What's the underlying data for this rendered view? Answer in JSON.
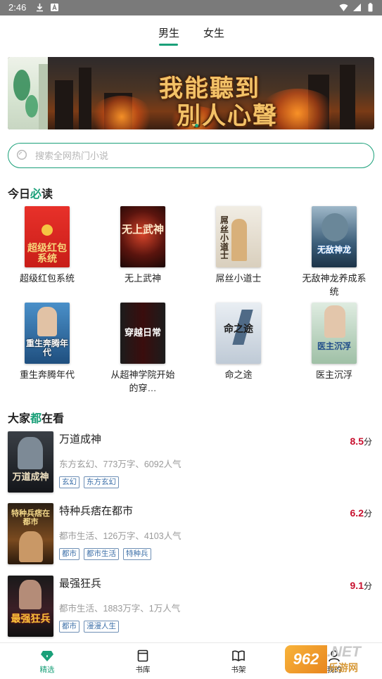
{
  "status_bar": {
    "time": "2:46"
  },
  "tabs": [
    {
      "label": "男生",
      "active": true
    },
    {
      "label": "女生",
      "active": false
    }
  ],
  "banner": {
    "title_line1": "我能聽到",
    "title_line2": "別人心聲"
  },
  "search": {
    "placeholder": "搜索全网热门小说"
  },
  "section_today": {
    "title_pre": "今日",
    "title_hl": "必",
    "title_post": "读"
  },
  "today_books": [
    {
      "title": "超级红包系统",
      "cover_text": "超级红包系统"
    },
    {
      "title": "无上武神",
      "cover_text": "无上武神"
    },
    {
      "title": "屌丝小道士",
      "cover_text": "屌丝小道士"
    },
    {
      "title": "无敌神龙养成系统",
      "cover_text": "无敌神龙"
    },
    {
      "title": "重生奔腾年代",
      "cover_text": "重生奔腾年代"
    },
    {
      "title": "从超神学院开始的穿…",
      "cover_text": "穿越日常"
    },
    {
      "title": "命之途",
      "cover_text": "命之途"
    },
    {
      "title": "医主沉浮",
      "cover_text": "医主沉浮"
    }
  ],
  "section_popular": {
    "title_pre": "大家",
    "title_hl": "都",
    "title_post": "在看"
  },
  "popular_books": [
    {
      "title": "万道成神",
      "meta": "东方玄幻、773万字、6092人气",
      "tags": [
        "玄幻",
        "东方玄幻"
      ],
      "score": "8.5",
      "unit": "分",
      "cover_text": "万道成神"
    },
    {
      "title": "特种兵痞在都市",
      "meta": "都市生活、126万字、4103人气",
      "tags": [
        "都市",
        "都市生活",
        "特种兵"
      ],
      "score": "6.2",
      "unit": "分",
      "cover_text": "特种兵痞在都市"
    },
    {
      "title": "最强狂兵",
      "meta": "都市生活、1883万字、1万人气",
      "tags": [
        "都市",
        "漫漫人生"
      ],
      "score": "9.1",
      "unit": "分",
      "cover_text": "最强狂兵"
    }
  ],
  "bottom_nav": [
    {
      "label": "精选",
      "icon": "diamond-icon",
      "active": true
    },
    {
      "label": "书库",
      "icon": "book-library-icon",
      "active": false
    },
    {
      "label": "书架",
      "icon": "open-book-icon",
      "active": false
    },
    {
      "label": "我的",
      "icon": "profile-icon",
      "active": false
    }
  ],
  "watermark": {
    "badge": "962",
    "net": ".NET",
    "sub": "乐游网"
  },
  "colors": {
    "accent": "#1aa079",
    "score": "#c8102e",
    "tag": "#3c6fa8"
  }
}
